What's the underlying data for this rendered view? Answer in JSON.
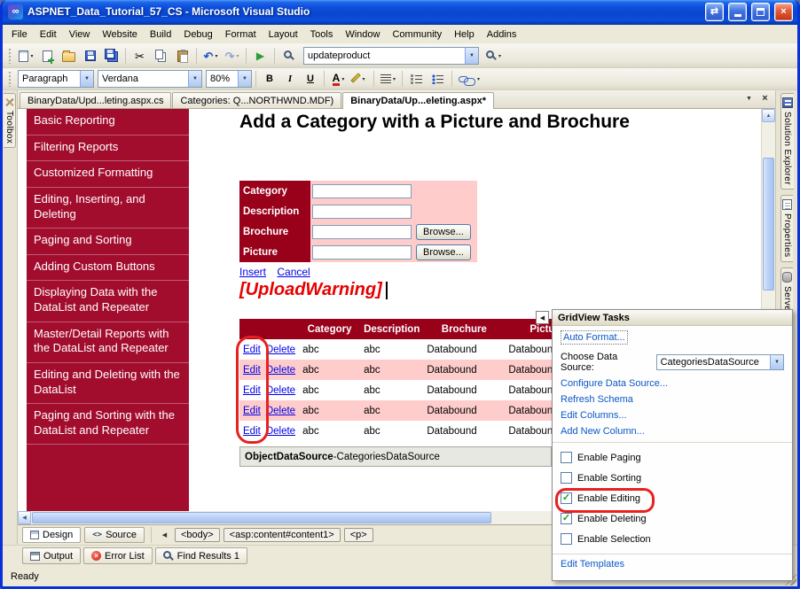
{
  "window": {
    "title": "ASPNET_Data_Tutorial_57_CS - Microsoft Visual Studio",
    "status_ready": "Ready"
  },
  "icons": {
    "vs_logo": "∞",
    "restore": "⇄",
    "close": "×",
    "cut": "✂",
    "undo": "↶",
    "redo": "↷",
    "play": "▶",
    "dropdown": "▾",
    "combo_arrow": "▼",
    "left": "◀",
    "right": "▶",
    "up": "▲",
    "down": "▼",
    "code": "<>",
    "error_x": "×"
  },
  "menu": {
    "items": [
      "File",
      "Edit",
      "View",
      "Website",
      "Build",
      "Debug",
      "Format",
      "Layout",
      "Tools",
      "Window",
      "Community",
      "Help",
      "Addins"
    ]
  },
  "toolbar": {
    "search_value": "updateproduct"
  },
  "format_toolbar": {
    "style": "Paragraph",
    "font": "Verdana",
    "size": "80%",
    "bold": "B",
    "italic": "I",
    "underline": "U",
    "font_color_letter": "A"
  },
  "toolbox_tab": "Toolbox",
  "doc_tabs": [
    {
      "label": "BinaryData/Upd...leting.aspx.cs"
    },
    {
      "label": "Categories: Q...NORTHWND.MDF)"
    },
    {
      "label": "BinaryData/Up...eleting.aspx*"
    }
  ],
  "right_tabs": [
    {
      "label": "Solution Explorer"
    },
    {
      "label": "Properties"
    },
    {
      "label": "Server E..."
    }
  ],
  "design": {
    "sidebar_items": [
      "Basic Reporting",
      "Filtering Reports",
      "Customized Formatting",
      "Editing, Inserting, and Deleting",
      "Paging and Sorting",
      "Adding Custom Buttons",
      "Displaying Data with the DataList and Repeater",
      "Master/Detail Reports with the DataList and Repeater",
      "Editing and Deleting with the DataList",
      "Paging and Sorting with the DataList and Repeater"
    ],
    "heading": "Add a Category with a Picture and Brochure",
    "form": {
      "rows": [
        {
          "label": "Category"
        },
        {
          "label": "Description"
        },
        {
          "label": "Brochure",
          "browse": "Browse..."
        },
        {
          "label": "Picture",
          "browse": "Browse..."
        }
      ],
      "insert": "Insert",
      "cancel": "Cancel"
    },
    "upload_warning": "[UploadWarning]",
    "grid": {
      "headers": [
        "",
        "Category",
        "Description",
        "Brochure",
        "Picture"
      ],
      "rows": [
        {
          "edit": "Edit",
          "del": "Delete",
          "category": "abc",
          "description": "abc",
          "brochure": "Databound",
          "picture": "Databound"
        },
        {
          "edit": "Edit",
          "del": "Delete",
          "category": "abc",
          "description": "abc",
          "brochure": "Databound",
          "picture": "Databound"
        },
        {
          "edit": "Edit",
          "del": "Delete",
          "category": "abc",
          "description": "abc",
          "brochure": "Databound",
          "picture": "Databound"
        },
        {
          "edit": "Edit",
          "del": "Delete",
          "category": "abc",
          "description": "abc",
          "brochure": "Databound",
          "picture": "Databound"
        },
        {
          "edit": "Edit",
          "del": "Delete",
          "category": "abc",
          "description": "abc",
          "brochure": "Databound",
          "picture": "Databound"
        }
      ]
    },
    "datasource": {
      "type": "ObjectDataSource",
      "sep": " - ",
      "name": "CategoriesDataSource"
    }
  },
  "smart_tag": {
    "title": "GridView Tasks",
    "auto_format": "Auto Format...",
    "choose_label": "Choose Data Source:",
    "choose_value": "CategoriesDataSource",
    "links": [
      "Configure Data Source...",
      "Refresh Schema",
      "Edit Columns...",
      "Add New Column..."
    ],
    "checkboxes": [
      {
        "label": "Enable Paging",
        "mark": ""
      },
      {
        "label": "Enable Sorting",
        "mark": ""
      },
      {
        "label": "Enable Editing",
        "mark": "✓"
      },
      {
        "label": "Enable Deleting",
        "mark": "✓"
      },
      {
        "label": "Enable Selection",
        "mark": ""
      }
    ],
    "edit_templates": "Edit Templates"
  },
  "view_bar": {
    "design": "Design",
    "source": "Source",
    "tags": [
      "<body>",
      "<asp:content#content1>",
      "<p>"
    ]
  },
  "bottom_tabs": [
    "Output",
    "Error List",
    "Find Results 1"
  ],
  "colors": {
    "accent_red": "#99001A",
    "sidebar_red": "#A20D2E",
    "row_pink": "#FFCCCC",
    "titlebar_blue": "#0946CE"
  }
}
